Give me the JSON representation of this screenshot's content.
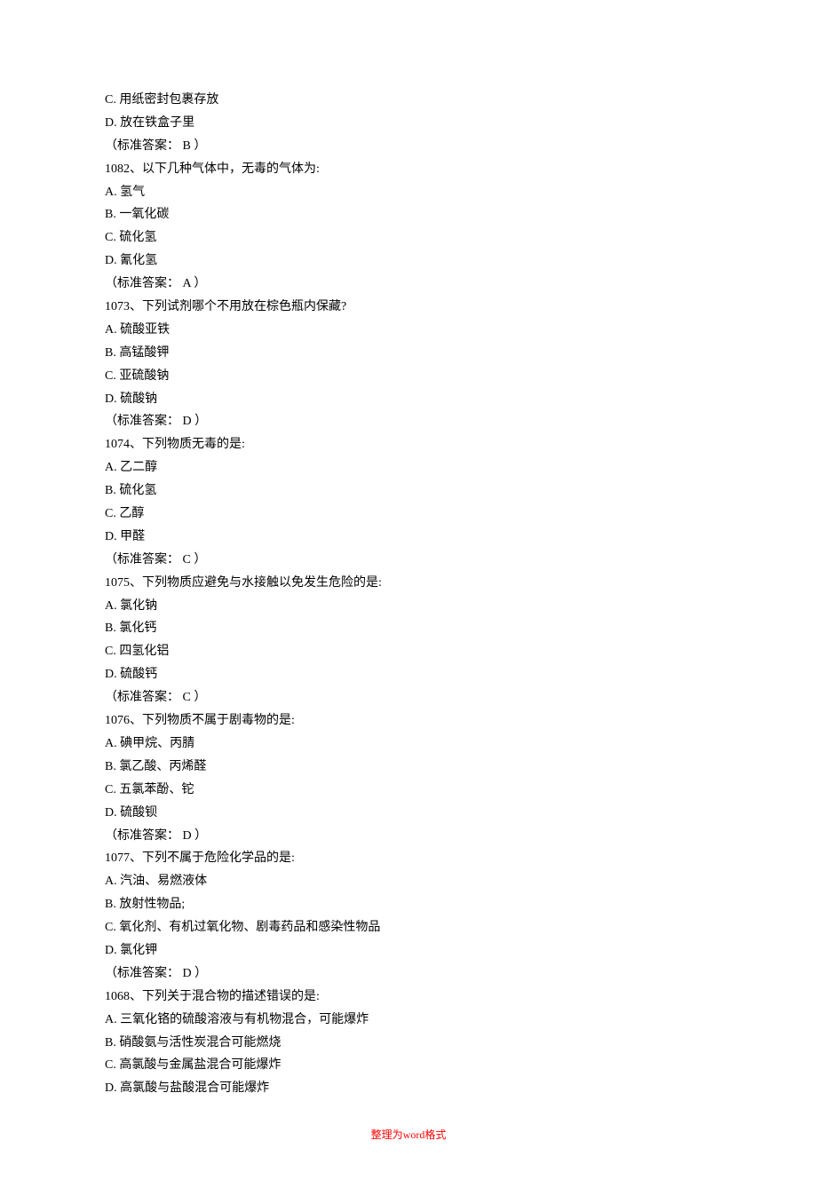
{
  "questions": [
    {
      "prefix_options": [
        {
          "label": "C",
          "text": "用纸密封包裹存放"
        },
        {
          "label": "D",
          "text": "放在铁盒子里"
        }
      ],
      "answer_prefix": "（标准答案： ",
      "answer": "B",
      "answer_suffix": " ）"
    },
    {
      "number": "1082",
      "stem": "以下几种气体中，无毒的气体为:",
      "options": [
        {
          "label": "A",
          "text": "氢气"
        },
        {
          "label": "B",
          "text": "一氧化碳"
        },
        {
          "label": "C",
          "text": "硫化氢"
        },
        {
          "label": "D",
          "text": "氰化氢"
        }
      ],
      "answer_prefix": "（标准答案： ",
      "answer": "A",
      "answer_suffix": " ）"
    },
    {
      "number": "1073",
      "stem": "下列试剂哪个不用放在棕色瓶内保藏?",
      "options": [
        {
          "label": "A",
          "text": "硫酸亚铁"
        },
        {
          "label": "B",
          "text": "高锰酸钾"
        },
        {
          "label": "C",
          "text": "亚硫酸钠"
        },
        {
          "label": "D",
          "text": "硫酸钠"
        }
      ],
      "answer_prefix": "（标准答案： ",
      "answer": "D",
      "answer_suffix": " ）"
    },
    {
      "number": "1074",
      "stem": "下列物质无毒的是:",
      "options": [
        {
          "label": "A",
          "text": "乙二醇"
        },
        {
          "label": "B",
          "text": "硫化氢"
        },
        {
          "label": "C",
          "text": "乙醇"
        },
        {
          "label": "D",
          "text": "甲醛"
        }
      ],
      "answer_prefix": "（标准答案： ",
      "answer": "C",
      "answer_suffix": " ）"
    },
    {
      "number": "1075",
      "stem": "下列物质应避免与水接触以免发生危险的是:",
      "options": [
        {
          "label": "A",
          "text": "氯化钠"
        },
        {
          "label": "B",
          "text": "氯化钙"
        },
        {
          "label": "C",
          "text": "四氢化铝"
        },
        {
          "label": "D",
          "text": "硫酸钙"
        }
      ],
      "answer_prefix": "（标准答案： ",
      "answer": "C",
      "answer_suffix": " ）"
    },
    {
      "number": "1076",
      "stem": "下列物质不属于剧毒物的是:",
      "options": [
        {
          "label": "A",
          "text": "碘甲烷、丙腈"
        },
        {
          "label": "B",
          "text": "氯乙酸、丙烯醛"
        },
        {
          "label": "C",
          "text": "五氯苯酚、铊"
        },
        {
          "label": "D",
          "text": "硫酸钡"
        }
      ],
      "answer_prefix": "（标准答案： ",
      "answer": "D",
      "answer_suffix": " ）"
    },
    {
      "number": "1077",
      "stem": "下列不属于危险化学品的是:",
      "options": [
        {
          "label": "A",
          "text": "汽油、易燃液体"
        },
        {
          "label": "B",
          "text": "放射性物品;"
        },
        {
          "label": "C",
          "text": "氧化剂、有机过氧化物、剧毒药品和感染性物品"
        },
        {
          "label": "D",
          "text": "氯化钾"
        }
      ],
      "answer_prefix": "（标准答案： ",
      "answer": "D",
      "answer_suffix": " ）"
    },
    {
      "number": "1068",
      "stem": "下列关于混合物的描述错误的是:",
      "options": [
        {
          "label": "A",
          "text": "三氧化铬的硫酸溶液与有机物混合，可能爆炸"
        },
        {
          "label": "B",
          "text": "硝酸氨与活性炭混合可能燃烧"
        },
        {
          "label": "C",
          "text": "高氯酸与金属盐混合可能爆炸"
        },
        {
          "label": "D",
          "text": "高氯酸与盐酸混合可能爆炸"
        }
      ]
    }
  ],
  "footer": {
    "prefix": "整理为",
    "word": "word",
    "suffix": "格式"
  },
  "separators": {
    "qnum": "、",
    "opt": ". "
  }
}
